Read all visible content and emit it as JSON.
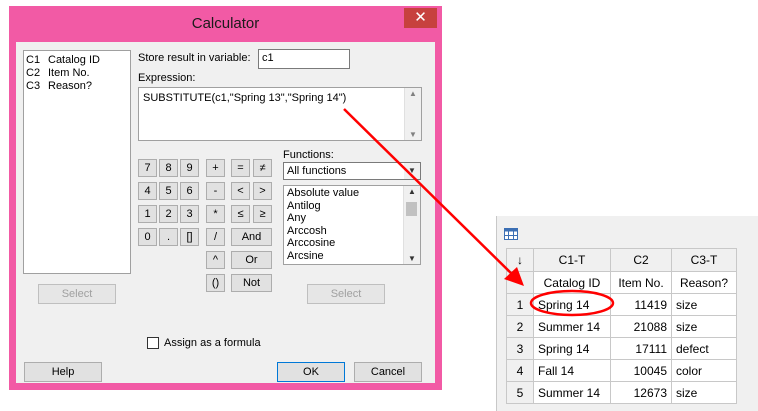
{
  "dialog": {
    "title": "Calculator",
    "close_symbol": "✕",
    "variables": [
      {
        "col": "C1",
        "name": "Catalog ID"
      },
      {
        "col": "C2",
        "name": "Item No."
      },
      {
        "col": "C3",
        "name": "Reason?"
      }
    ],
    "store_label": "Store result in variable:",
    "store_value": "c1",
    "expression_label": "Expression:",
    "expression_value": "SUBSTITUTE(c1,\"Spring 13\",\"Spring 14\")",
    "keypad": {
      "row1": [
        "7",
        "8",
        "9",
        "+",
        "=",
        "≠"
      ],
      "row2": [
        "4",
        "5",
        "6",
        "-",
        "<",
        ">"
      ],
      "row3": [
        "1",
        "2",
        "3",
        "*",
        "≤",
        "≥"
      ],
      "row4": [
        "0",
        ".",
        "[]",
        "/"
      ],
      "and": "And",
      "caret": "^",
      "or": "Or",
      "paren": "()",
      "not": "Not"
    },
    "functions_label": "Functions:",
    "functions_selected": "All functions",
    "functions_list": [
      "Absolute value",
      "Antilog",
      "Any",
      "Arccosh",
      "Arccosine",
      "Arcsine"
    ],
    "select_label": "Select",
    "assign_label": "Assign as a formula",
    "help_label": "Help",
    "ok_label": "OK",
    "cancel_label": "Cancel"
  },
  "worksheet": {
    "arrow_symbol": "↓",
    "column_ids": [
      "C1-T",
      "C2",
      "C3-T"
    ],
    "column_names": [
      "Catalog ID",
      "Item No.",
      "Reason?"
    ],
    "rows": [
      {
        "n": "1",
        "catalog": "Spring 14",
        "item": "11419",
        "reason": "size"
      },
      {
        "n": "2",
        "catalog": "Summer 14",
        "item": "21088",
        "reason": "size"
      },
      {
        "n": "3",
        "catalog": "Spring 14",
        "item": "17111",
        "reason": "defect"
      },
      {
        "n": "4",
        "catalog": "Fall 14",
        "item": "10045",
        "reason": "color"
      },
      {
        "n": "5",
        "catalog": "Summer 14",
        "item": "12673",
        "reason": "size"
      }
    ]
  },
  "colors": {
    "window_frame": "#f25aa5",
    "annotation": "#ff0000",
    "close_button": "#c7413e"
  }
}
